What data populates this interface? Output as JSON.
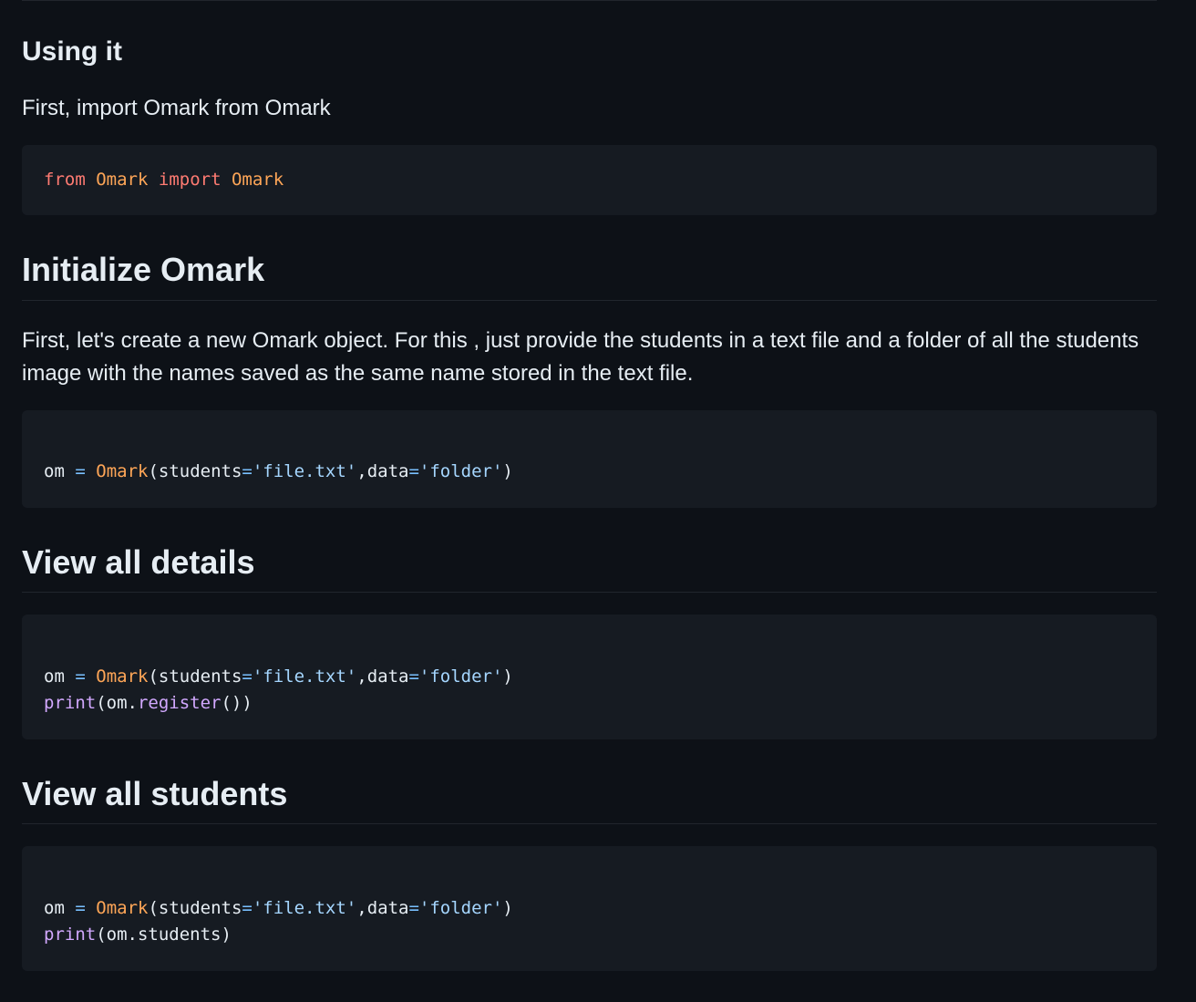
{
  "sections": {
    "using": {
      "heading": "Using it",
      "paragraph": "First, import Omark from Omark",
      "code": {
        "line1": {
          "kw_from": "from",
          "module": "Omark",
          "kw_import": "import",
          "name": "Omark"
        }
      }
    },
    "initialize": {
      "heading": "Initialize Omark",
      "paragraph": "First, let's create a new Omark object. For this , just provide the students in a text file and a folder of all the students image with the names saved as the same name stored in the text file.",
      "code": {
        "line1": {
          "var": "om",
          "eq": "=",
          "cls": "Omark",
          "open": "(students",
          "eq2": "=",
          "str1": "'file.txt'",
          "mid": ",data",
          "eq3": "=",
          "str2": "'folder'",
          "close": ")"
        }
      }
    },
    "details": {
      "heading": "View all details",
      "code": {
        "line1": {
          "var": "om",
          "eq": "=",
          "cls": "Omark",
          "open": "(students",
          "eq2": "=",
          "str1": "'file.txt'",
          "mid": ",data",
          "eq3": "=",
          "str2": "'folder'",
          "close": ")"
        },
        "line2": {
          "fn": "print",
          "open": "(om.",
          "method": "register",
          "close": "())"
        }
      }
    },
    "students": {
      "heading": "View all students",
      "code": {
        "line1": {
          "var": "om",
          "eq": "=",
          "cls": "Omark",
          "open": "(students",
          "eq2": "=",
          "str1": "'file.txt'",
          "mid": ",data",
          "eq3": "=",
          "str2": "'folder'",
          "close": ")"
        },
        "line2": {
          "fn": "print",
          "rest": "(om.students)"
        }
      }
    }
  }
}
